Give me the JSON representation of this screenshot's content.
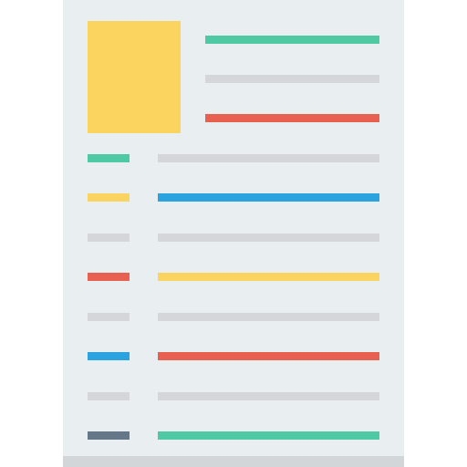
{
  "colors": {
    "background": "#ffffff",
    "paper": "#e9eef1",
    "paper_footer": "#d2d6d9",
    "yellow": "#fbd45f",
    "green": "#4ec9a2",
    "gray": "#d4d6d9",
    "red": "#e8604f",
    "blue": "#2ba3df",
    "slate": "#64788a"
  },
  "icon": {
    "name": "document-icon",
    "photo_color": "yellow",
    "header_lines": [
      "green",
      "gray",
      "red"
    ],
    "rows": [
      {
        "label": "green",
        "value": "gray"
      },
      {
        "label": "yellow",
        "value": "blue"
      },
      {
        "label": "gray",
        "value": "gray"
      },
      {
        "label": "red",
        "value": "yellow"
      },
      {
        "label": "gray",
        "value": "gray"
      },
      {
        "label": "blue",
        "value": "red"
      },
      {
        "label": "gray",
        "value": "gray"
      },
      {
        "label": "slate",
        "value": "green"
      }
    ]
  }
}
